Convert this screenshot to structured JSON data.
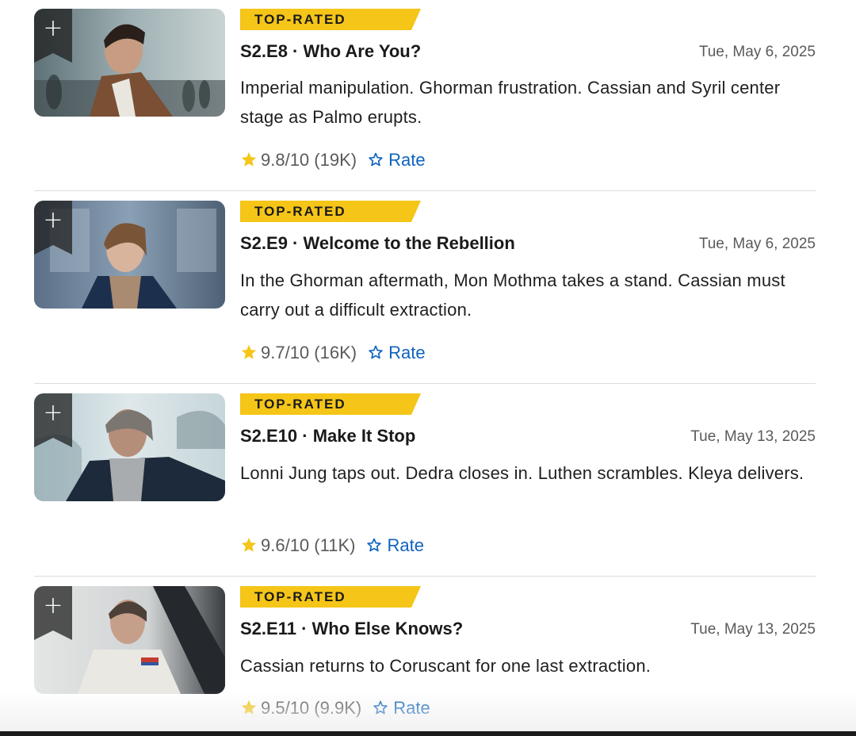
{
  "episodes": [
    {
      "badge": "TOP-RATED",
      "title": "S2.E8 · Who Are You?",
      "date": "Tue, May 6, 2025",
      "plot": "Imperial manipulation. Ghorman frustration. Cassian and Syril center stage as Palmo erupts.",
      "rating": "9.8/10",
      "votes": "(19K)",
      "rate_label": "Rate",
      "watchlist_label": "+"
    },
    {
      "badge": "TOP-RATED",
      "title": "S2.E9 · Welcome to the Rebellion",
      "date": "Tue, May 6, 2025",
      "plot": "In the Ghorman aftermath, Mon Mothma takes a stand. Cassian must carry out a difficult extraction.",
      "rating": "9.7/10",
      "votes": "(16K)",
      "rate_label": "Rate",
      "watchlist_label": "+"
    },
    {
      "badge": "TOP-RATED",
      "title": "S2.E10 · Make It Stop",
      "date": "Tue, May 13, 2025",
      "plot": "Lonni Jung taps out. Dedra closes in. Luthen scrambles. Kleya delivers.",
      "rating": "9.6/10",
      "votes": "(11K)",
      "rate_label": "Rate",
      "watchlist_label": "+"
    },
    {
      "badge": "TOP-RATED",
      "title": "S2.E11 · Who Else Knows?",
      "date": "Tue, May 13, 2025",
      "plot": "Cassian returns to Coruscant for one last extraction.",
      "rating": "9.5/10",
      "votes": "(9.9K)",
      "rate_label": "Rate",
      "watchlist_label": "+"
    }
  ],
  "colors": {
    "badge": "#f5c518",
    "star": "#f5c518",
    "rate_link": "#0e63be",
    "muted_text": "#5a5a5a"
  }
}
